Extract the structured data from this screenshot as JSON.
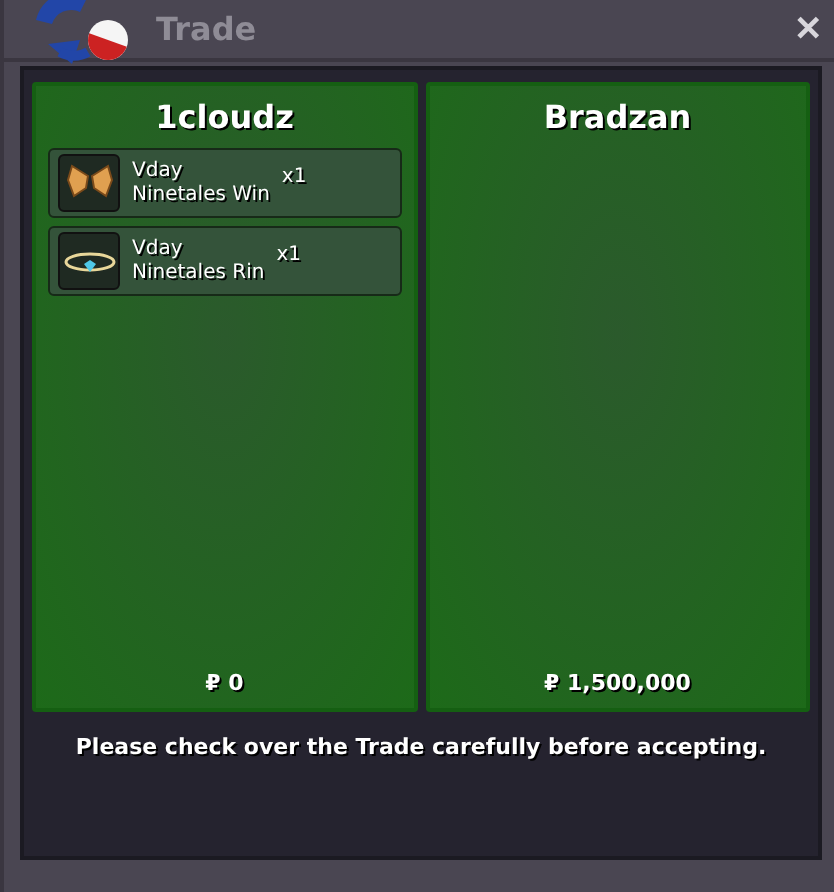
{
  "window": {
    "title": "Trade",
    "close": "✕"
  },
  "sides": [
    {
      "name": "1cloudz",
      "money": "₽ 0",
      "items": [
        {
          "kind": "wings",
          "line1": "Vday",
          "line2": "Ninetales Win",
          "qty": "x1"
        },
        {
          "kind": "ring",
          "line1": "Vday",
          "line2": "Ninetales Rin",
          "qty": "x1"
        }
      ]
    },
    {
      "name": "Bradzan",
      "money": "₽ 1,500,000"
    }
  ],
  "message": "Please check over the Trade carefully before accepting."
}
